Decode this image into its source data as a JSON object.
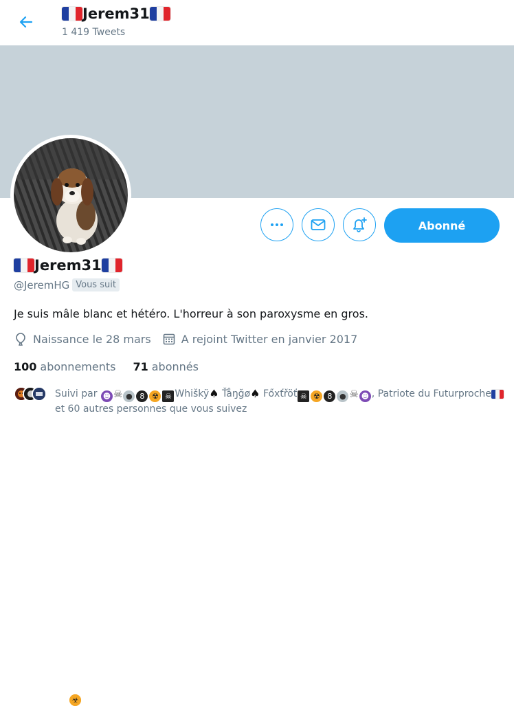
{
  "header": {
    "display_name": "Jerem31",
    "tweet_count": "1 419 Tweets"
  },
  "profile": {
    "display_name": "Jerem31",
    "handle": "@JeremHG",
    "follows_you": "Vous suit",
    "bio": "Je suis mâle blanc et hétéro. L'horreur à son paroxysme en gros.",
    "birthday": "Naissance le 28 mars",
    "joined": "A rejoint Twitter en janvier 2017",
    "following_count": "100",
    "following_label": "abonnements",
    "followers_count": "71",
    "followers_label": "abonnés"
  },
  "actions": {
    "follow_label": "Abonné"
  },
  "followed_by": {
    "prefix": "Suivi par",
    "name1": "Whiškÿ",
    "name2": "Ťåŋğø",
    "name3": "Főxťřöť",
    "name4": ", Patriote du Futurproche",
    "suffix": " et 60 autres personnes que vous suivez"
  },
  "colors": {
    "accent": "#1da1f2",
    "banner": "#c6d2d9",
    "muted": "#657786"
  }
}
